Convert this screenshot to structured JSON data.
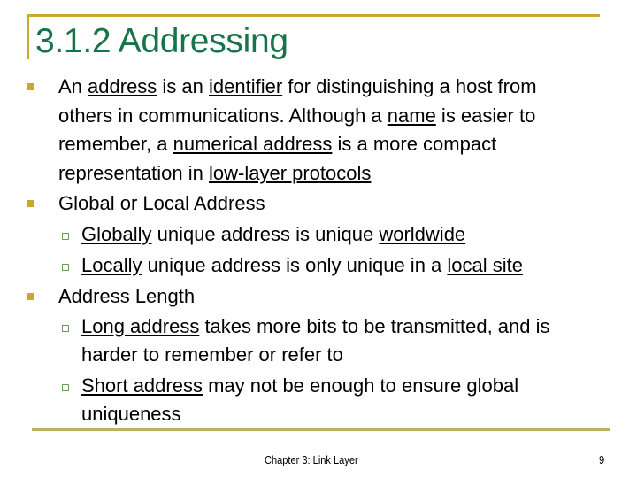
{
  "slide": {
    "title": "3.1.2 Addressing",
    "accent_color": "#cca92c",
    "title_color": "#17744a",
    "bullets": [
      {
        "lines": [
          [
            {
              "text": "An ",
              "u": false
            },
            {
              "text": "address",
              "u": true
            },
            {
              "text": " is an ",
              "u": false
            },
            {
              "text": "identifier",
              "u": true
            },
            {
              "text": " for distinguishing a host from",
              "u": false
            }
          ],
          [
            {
              "text": "others in communications. Although a ",
              "u": false
            },
            {
              "text": "name",
              "u": true
            },
            {
              "text": " is easier to",
              "u": false
            }
          ],
          [
            {
              "text": "remember, a ",
              "u": false
            },
            {
              "text": "numerical address",
              "u": true
            },
            {
              "text": " is a more compact",
              "u": false
            }
          ],
          [
            {
              "text": "representation in ",
              "u": false
            },
            {
              "text": "low-layer protocols",
              "u": true
            }
          ]
        ],
        "sub": []
      },
      {
        "lines": [
          [
            {
              "text": "Global or Local Address",
              "u": false
            }
          ]
        ],
        "sub": [
          {
            "lines": [
              [
                {
                  "text": "Globally",
                  "u": true
                },
                {
                  "text": " unique address is unique ",
                  "u": false
                },
                {
                  "text": "worldwide",
                  "u": true
                }
              ]
            ]
          },
          {
            "lines": [
              [
                {
                  "text": "Locally",
                  "u": true
                },
                {
                  "text": " unique address is only unique in a ",
                  "u": false
                },
                {
                  "text": "local site",
                  "u": true
                }
              ]
            ]
          }
        ]
      },
      {
        "lines": [
          [
            {
              "text": "Address Length",
              "u": false
            }
          ]
        ],
        "sub": [
          {
            "lines": [
              [
                {
                  "text": "Long address",
                  "u": true
                },
                {
                  "text": " takes more bits to be transmitted, and is",
                  "u": false
                }
              ],
              [
                {
                  "text": "harder to remember or refer to",
                  "u": false
                }
              ]
            ]
          },
          {
            "lines": [
              [
                {
                  "text": "Short address",
                  "u": true
                },
                {
                  "text": " may not be enough to ensure global",
                  "u": false
                }
              ],
              [
                {
                  "text": "uniqueness",
                  "u": false
                }
              ]
            ]
          }
        ]
      }
    ]
  },
  "footer": {
    "chapter": "Chapter 3: Link Layer",
    "page_number": "9"
  }
}
